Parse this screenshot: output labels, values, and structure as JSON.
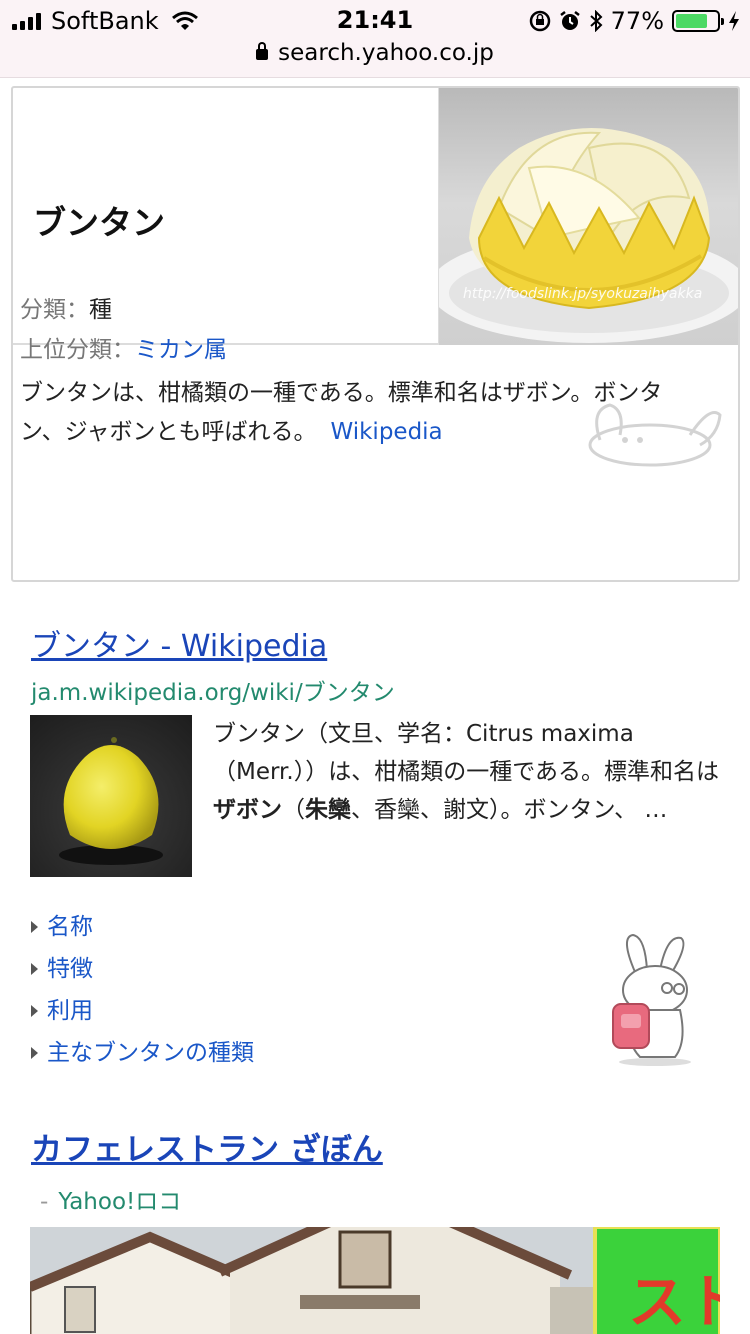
{
  "status_bar": {
    "carrier": "SoftBank",
    "time": "21:41",
    "battery": "77%",
    "battery_level": 0.77,
    "url": "search.yahoo.co.jp",
    "icons": [
      "signal-icon",
      "wifi-icon",
      "rotation-lock-icon",
      "alarm-icon",
      "bluetooth-icon",
      "battery-icon",
      "charging-icon",
      "lock-icon"
    ]
  },
  "knowledge_card": {
    "title": "ブンタン",
    "image_watermark": "http://foodslink.jp/syokuzaihyakka",
    "classification_label": "分類：",
    "classification_value": "種",
    "parent_label": "上位分類：",
    "parent_value": "ミカン属",
    "description": "ブンタンは、柑橘類の一種である。標準和名はザボン。ボンタン、ジャボンとも呼ばれる。",
    "source_link": "Wikipedia"
  },
  "result1": {
    "title": "ブンタン - Wikipedia",
    "url": "ja.m.wikipedia.org/wiki/ブンタン",
    "snippet_a": "ブンタン（文旦、学名：Citrus maxima （Merr.））は、柑橘類の一種である。標準和名は",
    "snippet_b1": "ザボン",
    "snippet_c": "（",
    "snippet_b2": "朱欒",
    "snippet_d": "、香欒、謝文）。ボンタン、 …",
    "sub_links": [
      "名称",
      "特徴",
      "利用",
      "主なブンタンの種類"
    ]
  },
  "result2": {
    "title": "カフェレストラン ざぼん",
    "source_dash": "-",
    "source": "Yahoo!ロコ",
    "sign_text": "ストラン ぼん"
  },
  "colors": {
    "link": "#1a45b8",
    "url_green": "#238a6e",
    "battery_green": "#4cd964"
  }
}
